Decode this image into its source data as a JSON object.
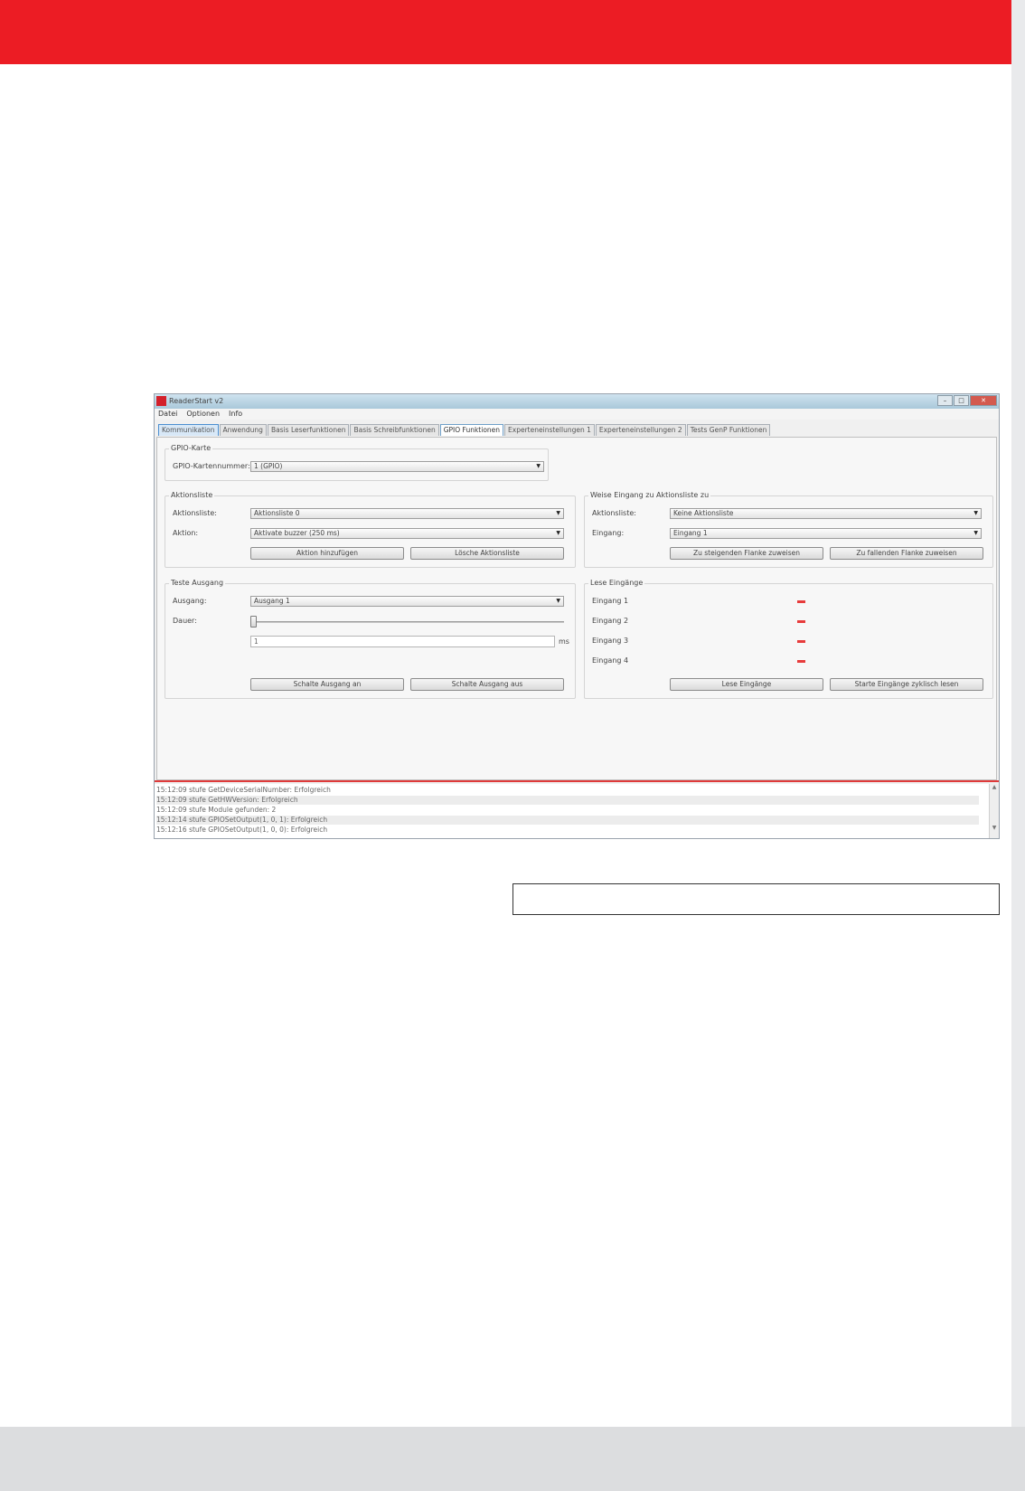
{
  "colors": {
    "brand_red": "#ec1c24",
    "footer_gray": "#dcdddf"
  },
  "window": {
    "title": "ReaderStart v2",
    "controls": [
      "–",
      "□",
      "✕"
    ]
  },
  "menu": [
    "Datei",
    "Optionen",
    "Info"
  ],
  "tabs": [
    "Kommunikation",
    "Anwendung",
    "Basis Leserfunktionen",
    "Basis Schreibfunktionen",
    "GPIO Funktionen",
    "Experteneinstellungen 1",
    "Experteneinstellungen 2",
    "Tests GenP Funktionen"
  ],
  "active_tab": "GPIO Funktionen",
  "gpio_card": {
    "group_label": "GPIO-Karte",
    "number_label": "GPIO-Kartennummer:",
    "number_value": "1 (GPIO)"
  },
  "action_list": {
    "group_label": "Aktionsliste",
    "list_label": "Aktionsliste:",
    "list_value": "Aktionsliste 0",
    "action_label": "Aktion:",
    "action_value": "Aktivate buzzer (250 ms)",
    "add_button": "Aktion hinzufügen",
    "delete_button": "Lösche Aktionsliste"
  },
  "assign_input": {
    "group_label": "Weise Eingang zu Aktionsliste zu",
    "list_label": "Aktionsliste:",
    "list_value": "Keine Aktionsliste",
    "input_label": "Eingang:",
    "input_value": "Eingang 1",
    "rising_button": "Zu steigenden Flanke zuweisen",
    "falling_button": "Zu fallenden Flanke zuweisen"
  },
  "test_output": {
    "group_label": "Teste Ausgang",
    "output_label": "Ausgang:",
    "output_value": "Ausgang 1",
    "duration_label": "Dauer:",
    "duration_value": "1",
    "unit": "ms",
    "on_button": "Schalte Ausgang an",
    "off_button": "Schalte Ausgang aus"
  },
  "read_inputs": {
    "group_label": "Lese Eingänge",
    "inputs": [
      "Eingang 1",
      "Eingang 2",
      "Eingang 3",
      "Eingang 4"
    ],
    "read_button": "Lese Eingänge",
    "cyclic_button": "Starte Eingänge zyklisch lesen"
  },
  "log": [
    "15:12:09 stufe GetDeviceSerialNumber: Erfolgreich",
    "15:12:09 stufe GetHWVersion: Erfolgreich",
    "15:12:09 stufe Module gefunden: 2",
    "15:12:14 stufe GPIOSetOutput(1, 0, 1): Erfolgreich",
    "15:12:16 stufe GPIOSetOutput(1, 0, 0): Erfolgreich"
  ]
}
